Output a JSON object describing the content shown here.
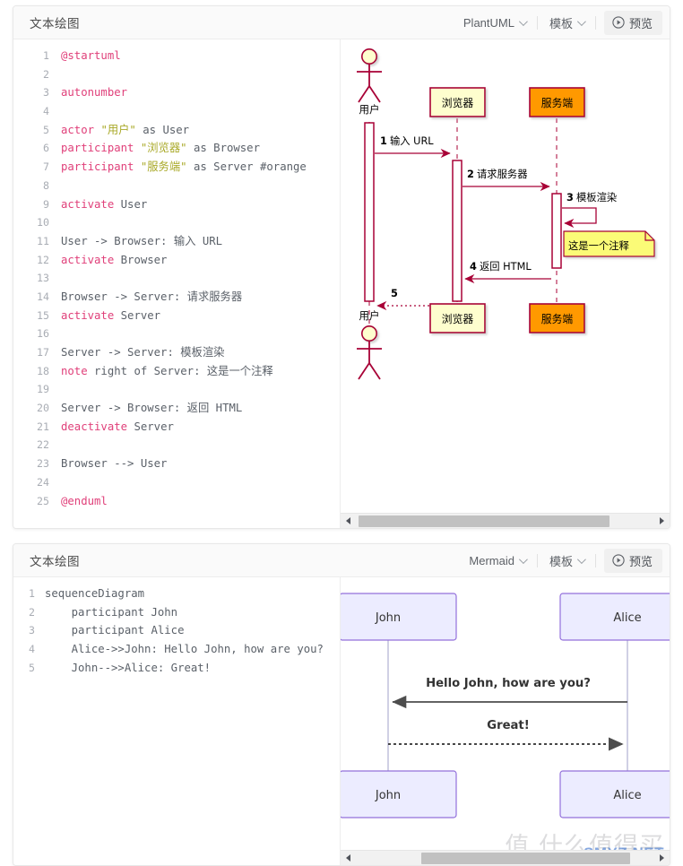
{
  "panels": [
    {
      "title": "文本绘图",
      "engine": "PlantUML",
      "template_label": "模板",
      "preview_label": "预览",
      "code_lines": [
        {
          "n": "1",
          "tokens": [
            {
              "t": "@startuml",
              "c": "k"
            }
          ]
        },
        {
          "n": "2",
          "tokens": []
        },
        {
          "n": "3",
          "tokens": [
            {
              "t": "autonumber",
              "c": "k"
            }
          ]
        },
        {
          "n": "4",
          "tokens": []
        },
        {
          "n": "5",
          "tokens": [
            {
              "t": "actor",
              "c": "k"
            },
            {
              "t": " ",
              "c": "pl"
            },
            {
              "t": "\"用户\"",
              "c": "s"
            },
            {
              "t": " as User",
              "c": "pl"
            }
          ]
        },
        {
          "n": "6",
          "tokens": [
            {
              "t": "participant",
              "c": "k"
            },
            {
              "t": " ",
              "c": "pl"
            },
            {
              "t": "\"浏览器\"",
              "c": "s"
            },
            {
              "t": " as Browser",
              "c": "pl"
            }
          ]
        },
        {
          "n": "7",
          "tokens": [
            {
              "t": "participant",
              "c": "k"
            },
            {
              "t": " ",
              "c": "pl"
            },
            {
              "t": "\"服务端\"",
              "c": "s"
            },
            {
              "t": " as Server #orange",
              "c": "pl"
            }
          ]
        },
        {
          "n": "8",
          "tokens": []
        },
        {
          "n": "9",
          "tokens": [
            {
              "t": "activate",
              "c": "k"
            },
            {
              "t": " User",
              "c": "pl"
            }
          ]
        },
        {
          "n": "10",
          "tokens": []
        },
        {
          "n": "11",
          "tokens": [
            {
              "t": "User -> Browser: 输入 URL",
              "c": "pl"
            }
          ]
        },
        {
          "n": "12",
          "tokens": [
            {
              "t": "activate",
              "c": "k"
            },
            {
              "t": " Browser",
              "c": "pl"
            }
          ]
        },
        {
          "n": "13",
          "tokens": []
        },
        {
          "n": "14",
          "tokens": [
            {
              "t": "Browser -> Server: 请求服务器",
              "c": "pl"
            }
          ]
        },
        {
          "n": "15",
          "tokens": [
            {
              "t": "activate",
              "c": "k"
            },
            {
              "t": " Server",
              "c": "pl"
            }
          ]
        },
        {
          "n": "16",
          "tokens": []
        },
        {
          "n": "17",
          "tokens": [
            {
              "t": "Server -> Server: 模板渲染",
              "c": "pl"
            }
          ]
        },
        {
          "n": "18",
          "tokens": [
            {
              "t": "note",
              "c": "k"
            },
            {
              "t": " right of Server: 这是一个注释",
              "c": "pl"
            }
          ]
        },
        {
          "n": "19",
          "tokens": []
        },
        {
          "n": "20",
          "tokens": [
            {
              "t": "Server -> Browser: 返回 HTML",
              "c": "pl"
            }
          ]
        },
        {
          "n": "21",
          "tokens": [
            {
              "t": "deactivate",
              "c": "k"
            },
            {
              "t": " Server",
              "c": "pl"
            }
          ]
        },
        {
          "n": "22",
          "tokens": []
        },
        {
          "n": "23",
          "tokens": [
            {
              "t": "Browser --> User",
              "c": "pl"
            }
          ]
        },
        {
          "n": "24",
          "tokens": []
        },
        {
          "n": "25",
          "tokens": [
            {
              "t": "@enduml",
              "c": "k"
            }
          ]
        }
      ]
    },
    {
      "title": "文本绘图",
      "engine": "Mermaid",
      "template_label": "模板",
      "preview_label": "预览",
      "code_lines": [
        {
          "n": "1",
          "tokens": [
            {
              "t": "sequenceDiagram",
              "c": "pl"
            }
          ]
        },
        {
          "n": "2",
          "tokens": [
            {
              "t": "    participant John",
              "c": "pl"
            }
          ]
        },
        {
          "n": "3",
          "tokens": [
            {
              "t": "    participant Alice",
              "c": "pl"
            }
          ]
        },
        {
          "n": "4",
          "tokens": [
            {
              "t": "    Alice->>John: Hello John, how are you?",
              "c": "pl"
            }
          ]
        },
        {
          "n": "5",
          "tokens": [
            {
              "t": "    John-->>Alice: Great!",
              "c": "pl"
            }
          ]
        }
      ]
    }
  ],
  "chart_data": [
    {
      "type": "sequence-diagram",
      "engine": "PlantUML",
      "participants": [
        {
          "name": "用户",
          "alias": "User",
          "kind": "actor",
          "fill": "#FEFECE",
          "stroke": "#A80036"
        },
        {
          "name": "浏览器",
          "alias": "Browser",
          "kind": "participant",
          "fill": "#FEFECE",
          "stroke": "#A80036"
        },
        {
          "name": "服务端",
          "alias": "Server",
          "kind": "participant",
          "fill": "#FF9900",
          "stroke": "#A80036"
        }
      ],
      "messages": [
        {
          "num": "1",
          "from": "用户",
          "to": "浏览器",
          "label": "输入 URL",
          "style": "solid"
        },
        {
          "num": "2",
          "from": "浏览器",
          "to": "服务端",
          "label": "请求服务器",
          "style": "solid"
        },
        {
          "num": "3",
          "from": "服务端",
          "to": "服务端",
          "label": "模板渲染",
          "style": "solid-self"
        },
        {
          "num": "4",
          "from": "服务端",
          "to": "浏览器",
          "label": "返回 HTML",
          "style": "solid"
        },
        {
          "num": "5",
          "from": "浏览器",
          "to": "用户",
          "label": "",
          "style": "dotted"
        }
      ],
      "notes": [
        {
          "text": "这是一个注释",
          "anchor": "right of 服务端",
          "fill": "#FBFB77",
          "stroke": "#A80036"
        }
      ],
      "autonumber": true
    },
    {
      "type": "sequence-diagram",
      "engine": "Mermaid",
      "participants": [
        {
          "name": "John",
          "fill": "#ECECFF",
          "stroke": "#9370DB"
        },
        {
          "name": "Alice",
          "fill": "#ECECFF",
          "stroke": "#9370DB"
        }
      ],
      "messages": [
        {
          "from": "Alice",
          "to": "John",
          "label": "Hello John, how are you?",
          "style": "solid"
        },
        {
          "from": "John",
          "to": "Alice",
          "label": "Great!",
          "style": "dotted"
        }
      ]
    }
  ],
  "scroll": {
    "uml_thumb_pct": "84",
    "mermaid_thumb_pct": "70"
  },
  "watermark": {
    "cn": "值 什么值得买",
    "net": "SMYZ.NET"
  },
  "colors": {
    "uml_stroke": "#A80036",
    "uml_note_fill": "#FBFB77",
    "uml_box_fill": "#FEFECE",
    "uml_orange": "#FF9900",
    "mermaid_box_fill": "#ECECFF",
    "mermaid_box_stroke": "#9370DB",
    "mermaid_line": "#4d4d4d",
    "panel_head_bg": "#FAFAFA",
    "code_keyword": "#E0407A",
    "code_string": "#A9A928"
  }
}
